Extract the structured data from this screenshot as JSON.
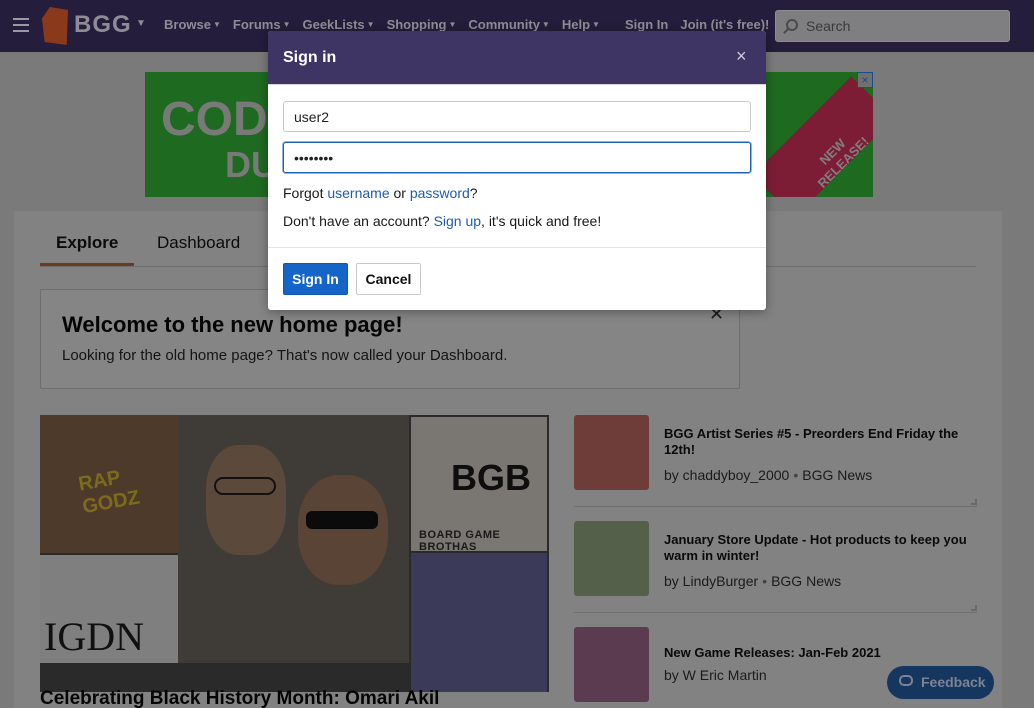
{
  "nav": {
    "logo_text": "BGG",
    "links": [
      "Browse",
      "Forums",
      "GeekLists",
      "Shopping",
      "Community",
      "Help"
    ],
    "sign_in": "Sign In",
    "join": "Join (it's free)!",
    "search_placeholder": "Search"
  },
  "ad": {
    "line1": "COD",
    "line2": "DUE",
    "tag_line1": "NEW",
    "tag_line2": "RELEASE!",
    "close": "×"
  },
  "tabs": {
    "explore": "Explore",
    "dashboard": "Dashboard"
  },
  "welcome": {
    "title": "Welcome to the new home page!",
    "text": "Looking for the old home page? That's now called your Dashboard.",
    "close": "✕"
  },
  "feature": {
    "title": "Celebrating Black History Month: Omari Akil",
    "image_text": {
      "rap": "RAP GODZ",
      "bgb": "BGB",
      "bgb_sub": "BOARD GAME BROTHAS",
      "igdn": "IGDN"
    }
  },
  "news": [
    {
      "title": "BGG Artist Series #5 - Preorders End Friday the 12th!",
      "author": "by chaddyboy_2000",
      "source": "BGG News",
      "thumb_color": "#6e3d3a"
    },
    {
      "title": "January Store Update - Hot products to keep you warm in winter!",
      "author": "by LindyBurger",
      "source": "BGG News",
      "thumb_color": "#54604a"
    },
    {
      "title": "New Game Releases: Jan-Feb 2021",
      "author": "by W Eric Martin",
      "source": "",
      "thumb_color": "#5a3b4f"
    }
  ],
  "feedback": {
    "label": "Feedback"
  },
  "modal": {
    "title": "Sign in",
    "close": "×",
    "username_value": "user2",
    "password_value": "••••••••",
    "forgot_prefix": "Forgot",
    "forgot_username": "username",
    "forgot_or": "or",
    "forgot_password": "password",
    "forgot_suffix": "?",
    "noaccount_prefix": "Don't have an account?",
    "signup_link": "Sign up",
    "noaccount_suffix": ", it's quick and free!",
    "signin_button": "Sign In",
    "cancel_button": "Cancel"
  },
  "colors": {
    "nav_bg": "#241d3b",
    "modal_header": "#3f3564",
    "primary_button": "#1565c8",
    "link": "#1d5db0"
  }
}
